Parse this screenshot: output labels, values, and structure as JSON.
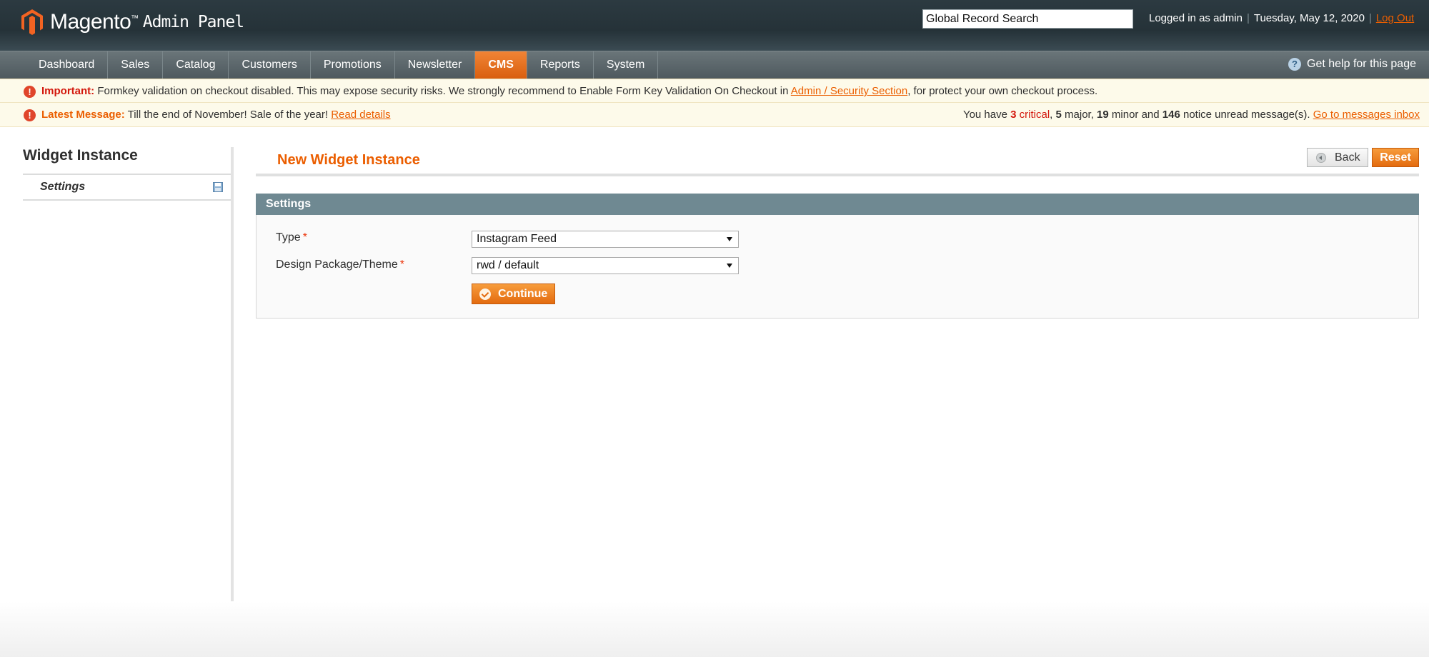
{
  "header": {
    "logo_name": "Magento",
    "logo_tm": "™",
    "logo_sub": "Admin Panel",
    "search_value": "Global Record Search",
    "logged_in": "Logged in as admin",
    "separator": "|",
    "date": "Tuesday, May 12, 2020",
    "logout": "Log Out"
  },
  "nav": {
    "items": [
      {
        "label": "Dashboard"
      },
      {
        "label": "Sales"
      },
      {
        "label": "Catalog"
      },
      {
        "label": "Customers"
      },
      {
        "label": "Promotions"
      },
      {
        "label": "Newsletter"
      },
      {
        "label": "CMS",
        "active": true
      },
      {
        "label": "Reports"
      },
      {
        "label": "System"
      }
    ],
    "help": "Get help for this page",
    "help_icon": "?"
  },
  "messages": {
    "important": {
      "icon": "!",
      "label": "Important:",
      "text": " Formkey validation on checkout disabled. This may expose security risks. We strongly recommend to Enable Form Key Validation On Checkout in ",
      "link": "Admin / Security Section",
      "tail": ", for protect your own checkout process."
    },
    "latest": {
      "icon": "!",
      "label": "Latest Message:",
      "text": " Till the end of November! Sale of the year! ",
      "link": "Read details",
      "summary_prefix": "You have ",
      "critical_count": "3",
      "critical_label": "critical",
      "major_count": "5",
      "major_label": " major, ",
      "minor_count": "19",
      "minor_label": " minor and ",
      "notice_count": "146",
      "notice_label": " notice unread message(s). ",
      "inbox_link": "Go to messages inbox"
    }
  },
  "sidebar": {
    "title": "Widget Instance",
    "tab": "Settings"
  },
  "main": {
    "title": "New Widget Instance",
    "back_label": "Back",
    "reset_label": "Reset",
    "section_title": "Settings",
    "type_label": "Type",
    "type_value": "Instagram Feed",
    "theme_label": "Design Package/Theme",
    "theme_value": "rwd / default",
    "required_mark": "*",
    "continue_label": "Continue"
  },
  "colors": {
    "accent": "#eb5e00",
    "header_bg": "#253238",
    "section_head": "#6f8992",
    "critical": "#d3170c"
  }
}
